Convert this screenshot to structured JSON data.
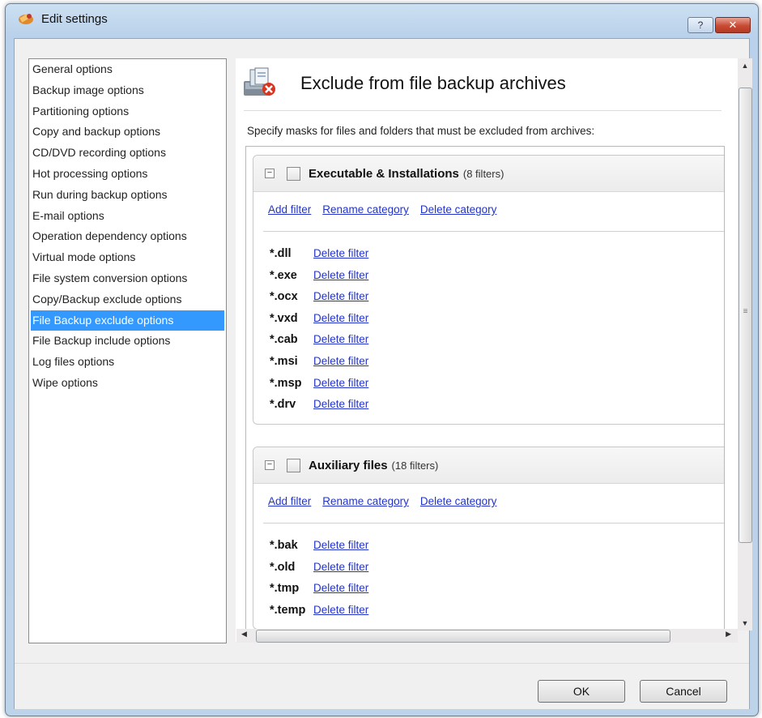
{
  "window": {
    "title": "Edit settings",
    "help_label": "?",
    "close_label": "✕"
  },
  "nav": {
    "items": [
      {
        "label": "General options"
      },
      {
        "label": "Backup image options"
      },
      {
        "label": "Partitioning options"
      },
      {
        "label": "Copy and backup options"
      },
      {
        "label": "CD/DVD recording options"
      },
      {
        "label": "Hot processing options"
      },
      {
        "label": "Run during backup options"
      },
      {
        "label": "E-mail options"
      },
      {
        "label": "Operation dependency options"
      },
      {
        "label": "Virtual mode options"
      },
      {
        "label": "File system conversion options"
      },
      {
        "label": "Copy/Backup exclude options"
      },
      {
        "label": "File Backup exclude options"
      },
      {
        "label": "File Backup include options"
      },
      {
        "label": "Log files options"
      },
      {
        "label": "Wipe options"
      }
    ],
    "selected": "File Backup exclude options"
  },
  "page": {
    "title": "Exclude from file backup archives",
    "instructions": "Specify masks for  files and folders that must be excluded from archives:",
    "action_labels": {
      "add_filter": "Add filter",
      "rename_category": "Rename category",
      "delete_category": "Delete category",
      "delete_filter": "Delete filter"
    },
    "groups": [
      {
        "name": "Executable & Installations",
        "count": "(8 filters)",
        "checked": false,
        "filters": [
          "*.dll",
          "*.exe",
          "*.ocx",
          "*.vxd",
          "*.cab",
          "*.msi",
          "*.msp",
          "*.drv"
        ]
      },
      {
        "name": "Auxiliary files",
        "count": "(18 filters)",
        "checked": false,
        "filters": [
          "*.bak",
          "*.old",
          "*.tmp",
          "*.temp"
        ]
      }
    ]
  },
  "footer": {
    "ok_label": "OK",
    "cancel_label": "Cancel"
  },
  "colors": {
    "selection": "#3399ff",
    "link": "#2233cc",
    "title_bar": "#b9d1ea"
  }
}
